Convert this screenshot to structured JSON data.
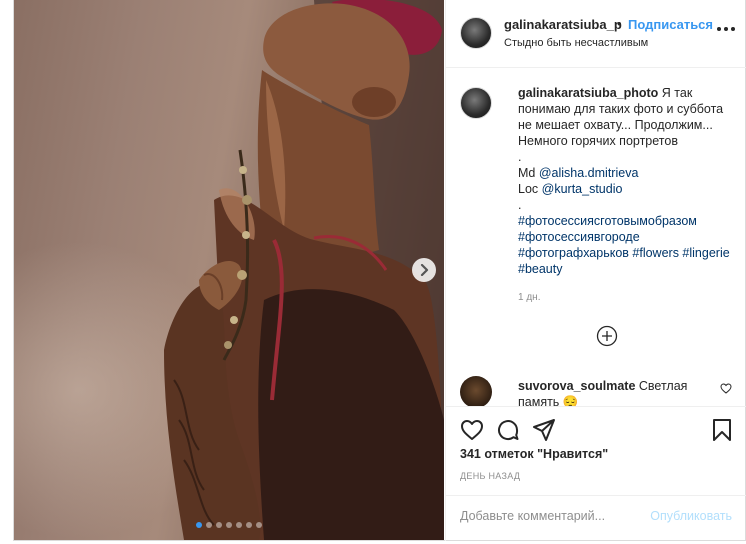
{
  "header": {
    "username": "galinakaratsiuba_p",
    "separator": "•",
    "follow_label": "Подписаться",
    "location": "Стыдно быть несчастливым"
  },
  "caption": {
    "username": "galinakaratsiuba_photo",
    "text_1": "Я так понимаю для таких фото и суббота не мешает охвату... Продолжим... Немного горячих портретов",
    "dot_1": ".",
    "md_prefix": "Md",
    "md_handle": "@alisha.dmitrieva",
    "loc_prefix": "Loc",
    "loc_handle": "@kurta_studio",
    "dot_2": ".",
    "hashtags": "#фотосессиясготовымобразом #фотосессиявгороде #фотографхарьков #flowers #lingerie #beauty",
    "time": "1 дн."
  },
  "comment": {
    "username": "suvorova_soulmate",
    "text": "Светлая память 😔"
  },
  "actions": {
    "likes": "341 отметок \"Нравится\"",
    "posted": "ДЕНЬ НАЗАД"
  },
  "add_comment": {
    "placeholder": "Добавьте комментарий...",
    "publish_label": "Опубликовать"
  },
  "carousel": {
    "total": 7,
    "active_index": 0,
    "active_color": "#3897f0"
  },
  "icons": [
    "next-arrow-icon",
    "more-options-icon",
    "load-more-plus-icon",
    "heart-icon",
    "comment-icon",
    "share-icon",
    "bookmark-icon",
    "small-heart-icon"
  ]
}
